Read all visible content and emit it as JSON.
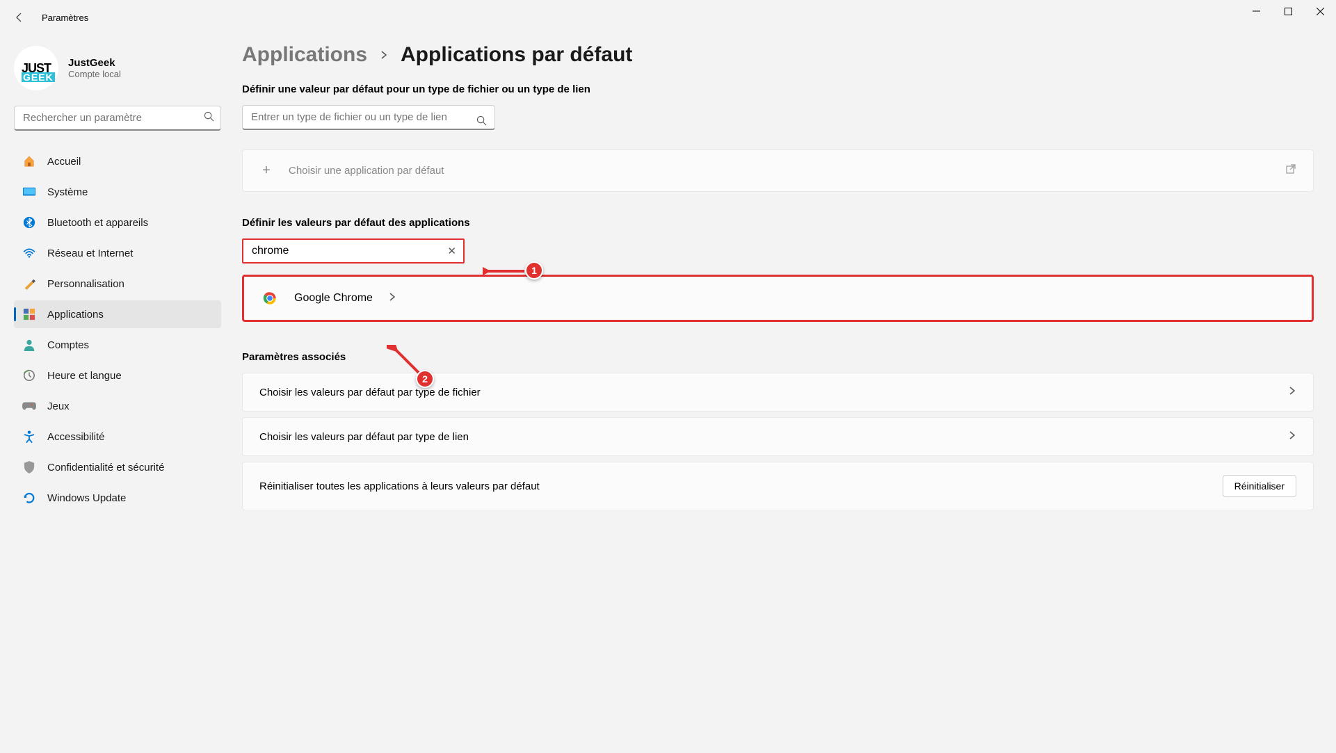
{
  "window": {
    "title": "Paramètres"
  },
  "user": {
    "name": "JustGeek",
    "type": "Compte local",
    "avatar_line1": "JUST",
    "avatar_line2": "GEEK"
  },
  "sidebar_search": {
    "placeholder": "Rechercher un paramètre"
  },
  "nav": [
    {
      "icon": "home",
      "label": "Accueil"
    },
    {
      "icon": "system",
      "label": "Système"
    },
    {
      "icon": "bluetooth",
      "label": "Bluetooth et appareils"
    },
    {
      "icon": "network",
      "label": "Réseau et Internet"
    },
    {
      "icon": "personalization",
      "label": "Personnalisation"
    },
    {
      "icon": "apps",
      "label": "Applications",
      "active": true
    },
    {
      "icon": "accounts",
      "label": "Comptes"
    },
    {
      "icon": "time",
      "label": "Heure et langue"
    },
    {
      "icon": "gaming",
      "label": "Jeux"
    },
    {
      "icon": "accessibility",
      "label": "Accessibilité"
    },
    {
      "icon": "privacy",
      "label": "Confidentialité et sécurité"
    },
    {
      "icon": "update",
      "label": "Windows Update"
    }
  ],
  "breadcrumb": {
    "parent": "Applications",
    "current": "Applications par défaut"
  },
  "section1": {
    "title": "Définir une valeur par défaut pour un type de fichier ou un type de lien",
    "search_placeholder": "Entrer un type de fichier ou un type de lien",
    "choose_default": "Choisir une application par défaut"
  },
  "section2": {
    "title": "Définir les valeurs par défaut des applications",
    "search_value": "chrome",
    "result_app": "Google Chrome"
  },
  "section3": {
    "title": "Paramètres associés",
    "by_filetype": "Choisir les valeurs par défaut par type de fichier",
    "by_linktype": "Choisir les valeurs par défaut par type de lien",
    "reset_text": "Réinitialiser toutes les applications à leurs valeurs par défaut",
    "reset_button": "Réinitialiser"
  },
  "annotations": {
    "marker1": "1",
    "marker2": "2"
  }
}
